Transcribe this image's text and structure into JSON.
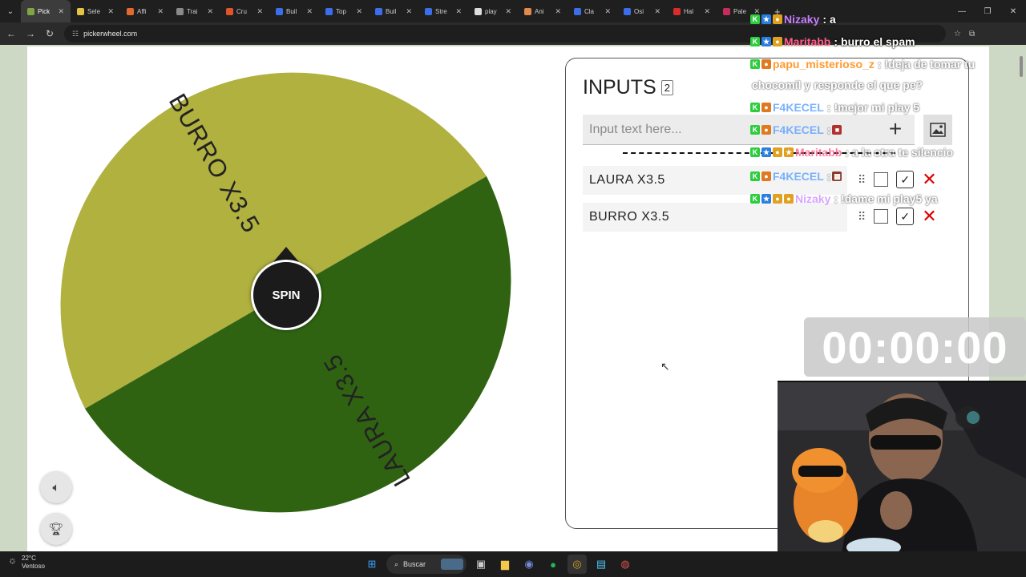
{
  "browser": {
    "tabs": [
      {
        "label": "Pick",
        "color": "#7fa642",
        "active": true
      },
      {
        "label": "Sele",
        "color": "#e4c542"
      },
      {
        "label": "Affi",
        "color": "#e06a2c"
      },
      {
        "label": "Trai",
        "color": "#8a8a8a"
      },
      {
        "label": "Cru",
        "color": "#e0542c"
      },
      {
        "label": "Buil",
        "color": "#3b6ee8"
      },
      {
        "label": "Top",
        "color": "#3b6ee8"
      },
      {
        "label": "Buil",
        "color": "#3b6ee8"
      },
      {
        "label": "Stre",
        "color": "#3b6ee8"
      },
      {
        "label": "play",
        "color": "#dddddd"
      },
      {
        "label": "Ani",
        "color": "#e08a4c"
      },
      {
        "label": "Cla",
        "color": "#3b6ee8"
      },
      {
        "label": "Osi",
        "color": "#3b6ee8"
      },
      {
        "label": "Hal",
        "color": "#d92c2c"
      },
      {
        "label": "Pale",
        "color": "#c82c5c"
      }
    ],
    "url": "pickerwheel.com"
  },
  "wheel": {
    "segments": [
      {
        "label": "BURRO X3.5",
        "color": "#b0b13f"
      },
      {
        "label": "LAURA X3.5",
        "color": "#2f6312"
      }
    ],
    "spin_label": "SPIN"
  },
  "inputs": {
    "title": "INPUTS",
    "count": "2",
    "placeholder": "Input text here...",
    "entries": [
      "LAURA X3.5",
      "BURRO X3.5"
    ]
  },
  "chat": [
    {
      "user": "Nizaky",
      "user_color": "#c77dff",
      "text": "a"
    },
    {
      "user": "Maritabb",
      "user_color": "#ff5c8a",
      "text": "burro el spam"
    },
    {
      "user": "papu_misterioso_z",
      "user_color": "#ff9a2e",
      "text": "!deja de tomar tu"
    },
    {
      "user": "",
      "user_color": "#ffffff",
      "text": "chocomil y responde el que pe?"
    },
    {
      "user": "F4KECEL",
      "user_color": "#5aa0ff",
      "text": "!mejor mi play 5"
    },
    {
      "user": "F4KECEL",
      "user_color": "#5aa0ff",
      "text": ""
    },
    {
      "user": "Maritabb",
      "user_color": "#ff5c8a",
      "text": "a la otra te silencio"
    },
    {
      "user": "F4KECEL",
      "user_color": "#5aa0ff",
      "text": ""
    },
    {
      "user": "Nizaky",
      "user_color": "#c77dff",
      "text": "!dame mi play5 ya"
    }
  ],
  "timer": "00:00:00",
  "taskbar": {
    "temperature": "22°C",
    "weather": "Ventoso",
    "search": "Buscar"
  }
}
